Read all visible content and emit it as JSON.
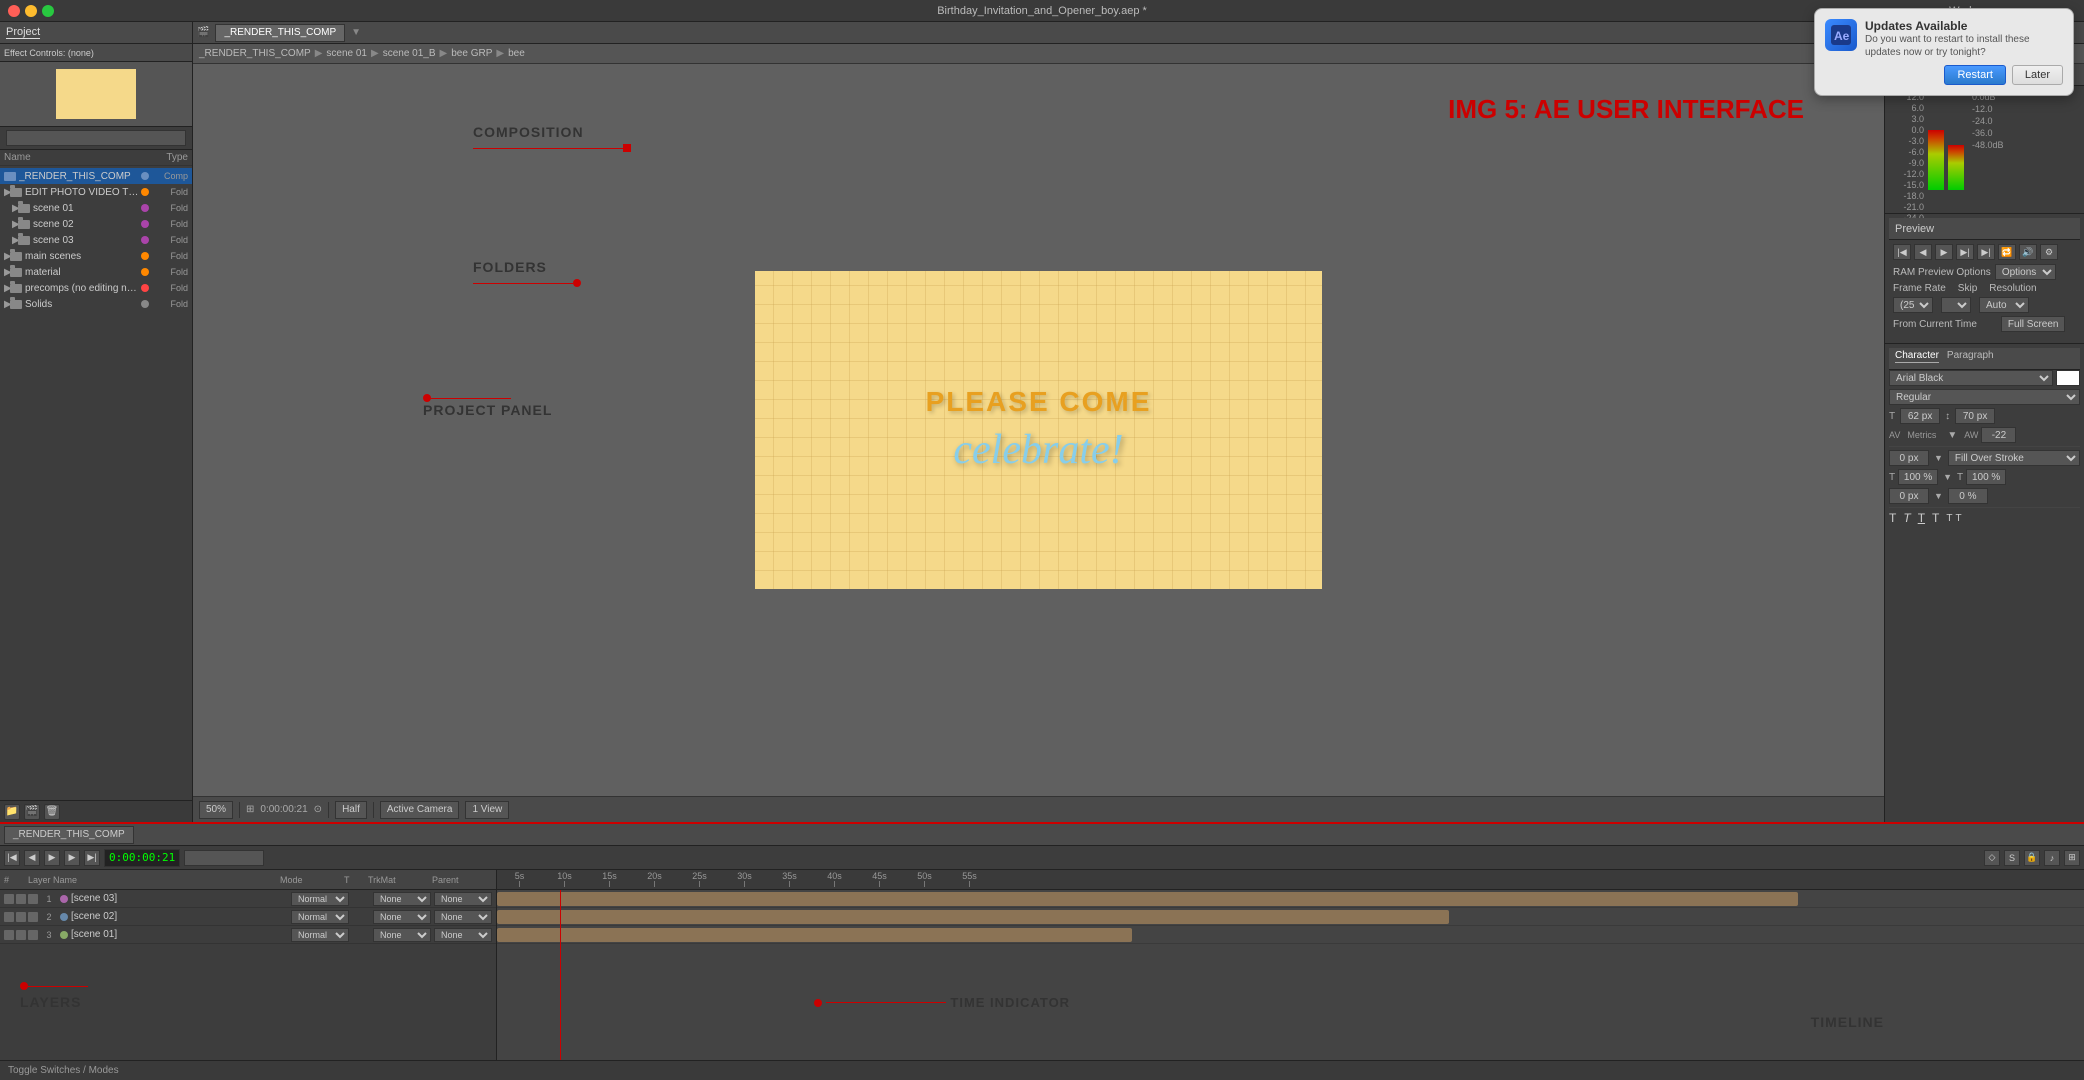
{
  "window": {
    "title": "Birthday_Invitation_and_Opener_boy.aep *",
    "traffic_lights": [
      "close",
      "minimize",
      "maximize"
    ],
    "workspace_label": "Workspace"
  },
  "update_dialog": {
    "title": "Updates Available",
    "text": "Do you want to restart to install these updates now or try tonight?",
    "restart_label": "Restart",
    "later_label": "Later"
  },
  "project_panel": {
    "tab_project": "Project",
    "tab_effect_controls": "Effect Controls: (none)",
    "search_placeholder": "",
    "columns": {
      "name": "Name",
      "type": "Type"
    },
    "items": [
      {
        "id": "render_comp",
        "name": "_RENDER_THIS_COMP",
        "type": "Comp",
        "color": "#6a8fc0",
        "indent": 0,
        "icon": "comp"
      },
      {
        "id": "edit_folder",
        "name": "EDIT PHOTO VIDEO TEXTS HERE",
        "type": "Fold",
        "color": "#ff8800",
        "indent": 0,
        "icon": "folder"
      },
      {
        "id": "scene01",
        "name": "scene 01",
        "type": "Fold",
        "color": "#aa44aa",
        "indent": 1,
        "icon": "folder"
      },
      {
        "id": "scene02",
        "name": "scene 02",
        "type": "Fold",
        "color": "#aa44aa",
        "indent": 1,
        "icon": "folder"
      },
      {
        "id": "scene03",
        "name": "scene 03",
        "type": "Fold",
        "color": "#aa44aa",
        "indent": 1,
        "icon": "folder"
      },
      {
        "id": "main_scenes",
        "name": "main scenes",
        "type": "Fold",
        "color": "#ff8800",
        "indent": 0,
        "icon": "folder"
      },
      {
        "id": "material",
        "name": "material",
        "type": "Fold",
        "color": "#ff8800",
        "indent": 0,
        "icon": "folder"
      },
      {
        "id": "precomps",
        "name": "precomps (no editing need)",
        "type": "Fold",
        "color": "#ff4444",
        "indent": 0,
        "icon": "folder"
      },
      {
        "id": "solids",
        "name": "Solids",
        "type": "Fold",
        "color": "#888888",
        "indent": 0,
        "icon": "folder"
      }
    ]
  },
  "composition": {
    "tabs": [
      "_RENDER_THIS_COMP"
    ],
    "active_tab": "_RENDER_THIS_COMP",
    "breadcrumb": [
      "_RENDER_THIS_COMP",
      "scene 01",
      "scene 01_B",
      "bee GRP",
      "bee"
    ],
    "text1": "PLEASE COME",
    "text2": "celebrate!",
    "controls": {
      "zoom": "50%",
      "timecode": "0:00:00:21",
      "resolution": "Half",
      "view": "Active Camera",
      "view_mode": "1 View"
    }
  },
  "audio_panel": {
    "labels": [
      "12.0",
      "6.0",
      "3.0",
      "0.0",
      "-3.0",
      "-6.0",
      "-9.0",
      "-12.0",
      "-15.0",
      "-18.0",
      "-21.0",
      "-24.0"
    ],
    "right_labels": [
      "0.0dB",
      "",
      "-12.0",
      "",
      "-24.0",
      "",
      "-36.0",
      "",
      "-48.0dB"
    ]
  },
  "preview_panel": {
    "title": "Preview",
    "ram_preview_label": "RAM Preview Options",
    "frame_rate_label": "Frame Rate",
    "skip_label": "Skip",
    "resolution_label": "Resolution",
    "frame_rate_value": "(25)",
    "skip_value": "",
    "resolution_value": "Auto",
    "from_current_time_label": "From Current Time",
    "full_screen_label": "Full Screen"
  },
  "character_panel": {
    "title": "Character",
    "tab_character": "Character",
    "tab_paragraph": "Paragraph",
    "font": "Arial Black",
    "style": "Regular",
    "size": "62 px",
    "line_height": "70 px",
    "tracking_label": "Metrics",
    "kern": "-22",
    "indent_left": "0 px",
    "fill": "Fill Over Stroke",
    "tsz_100": "100%",
    "tsz_vert": "100%",
    "baseline": "0 px",
    "tskew": "0%"
  },
  "timeline": {
    "tab": "_RENDER_THIS_COMP",
    "timecode": "0:00:00:21",
    "layers": [
      {
        "num": 1,
        "name": "[scene 03]",
        "mode": "Normal",
        "t": "",
        "trkmat": "None",
        "parent": "None",
        "color": "#aa66aa"
      },
      {
        "num": 2,
        "name": "[scene 02]",
        "mode": "Normal",
        "t": "",
        "trkmat": "None",
        "parent": "None",
        "color": "#6688aa"
      },
      {
        "num": 3,
        "name": "[scene 01]",
        "mode": "Normal",
        "t": "",
        "trkmat": "None",
        "parent": "None",
        "color": "#88aa66"
      }
    ],
    "ruler_marks": [
      "5s",
      "10s",
      "15s",
      "20s",
      "25s",
      "30s",
      "35s",
      "40s",
      "45s",
      "50s",
      "55s"
    ],
    "playhead_position": "4%",
    "bars": [
      {
        "layer": 1,
        "left": "0%",
        "width": "70%"
      },
      {
        "layer": 2,
        "left": "0%",
        "width": "55%"
      },
      {
        "layer": 3,
        "left": "0%",
        "width": "40%"
      }
    ]
  },
  "annotations": {
    "composition_label": "COMPOSITION",
    "folders_label": "FOLDERS",
    "project_panel_label": "PROJECT PANEL",
    "layers_label": "LAYERS",
    "time_indicator_label": "TIME INDICATOR",
    "timeline_label": "TIMELINE",
    "img5_label": "IMG 5:",
    "ae_ui_label": "AE USER INTERFACE"
  },
  "status_bar": {
    "item1": "Toggle Switches / Modes"
  }
}
